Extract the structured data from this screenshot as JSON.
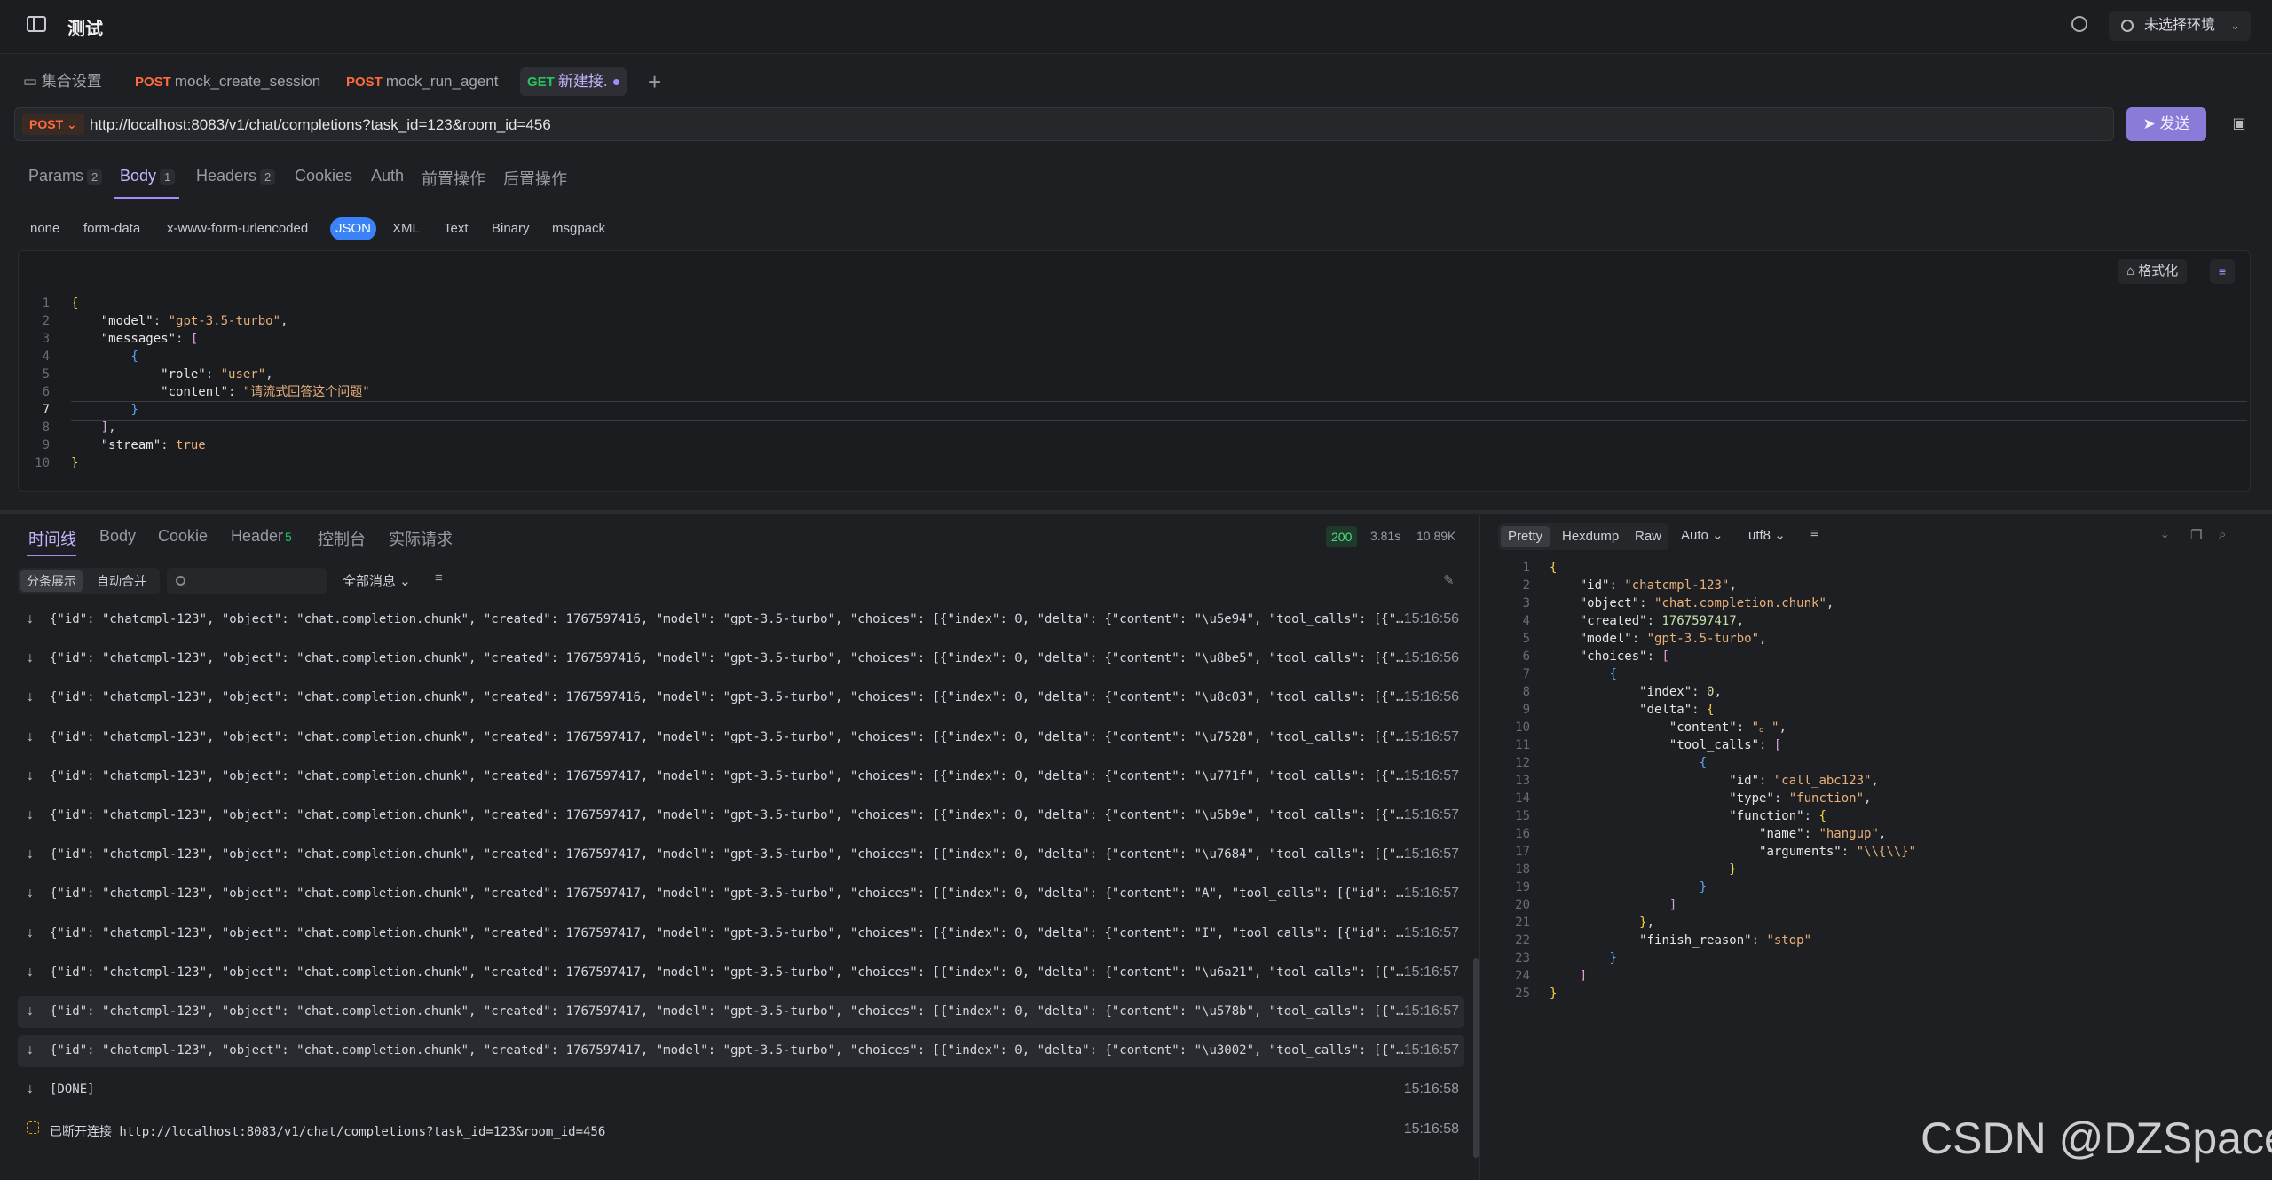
{
  "window": {
    "title": "测试"
  },
  "top_right": {
    "env_label": "未选择环境"
  },
  "tabs": [
    {
      "method": "",
      "label": "集合设置"
    },
    {
      "method": "POST",
      "label": "mock_create_session"
    },
    {
      "method": "POST",
      "label": "mock_run_agent"
    },
    {
      "method": "GET",
      "label": "新建接."
    }
  ],
  "request": {
    "method": "POST",
    "url": "http://localhost:8083/v1/chat/completions?task_id=123&room_id=456",
    "send_label": "发送"
  },
  "request_tabs": [
    {
      "label": "Params",
      "count": "2"
    },
    {
      "label": "Body",
      "count": "1"
    },
    {
      "label": "Headers",
      "count": "2"
    },
    {
      "label": "Cookies",
      "count": ""
    },
    {
      "label": "Auth",
      "count": ""
    },
    {
      "label": "前置操作",
      "count": ""
    },
    {
      "label": "后置操作",
      "count": ""
    }
  ],
  "body_types": [
    "none",
    "form-data",
    "x-www-form-urlencoded",
    "JSON",
    "XML",
    "Text",
    "Binary",
    "msgpack"
  ],
  "editor": {
    "format_label": "格式化",
    "lines": [
      "{",
      "    \"model\": \"gpt-3.5-turbo\",",
      "    \"messages\": [",
      "        {",
      "            \"role\": \"user\",",
      "            \"content\": \"请流式回答这个问题\"",
      "        }",
      "    ],",
      "    \"stream\": true",
      "}"
    ],
    "current_line": "7"
  },
  "response_tabs": [
    {
      "label": "时间线",
      "count": ""
    },
    {
      "label": "Body",
      "count": ""
    },
    {
      "label": "Cookie",
      "count": ""
    },
    {
      "label": "Header",
      "count": "5"
    },
    {
      "label": "控制台",
      "count": ""
    },
    {
      "label": "实际请求",
      "count": ""
    }
  ],
  "response_stats": {
    "status": "200",
    "time": "3.81s",
    "size": "10.89K"
  },
  "timeline": {
    "seg_split": "分条展示",
    "seg_merge": "自动合并",
    "filter_label": "全部消息",
    "events": [
      {
        "data": "{\"id\": \"chatcmpl-123\", \"object\": \"chat.completion.chunk\", \"created\": 1767597416, \"model\": \"gpt-3.5-turbo\", \"choices\": [{\"index\": 0, \"delta\": {\"content\": \"\\u5e94\", \"tool_calls\": [{\"i…",
        "time": "15:16:56"
      },
      {
        "data": "{\"id\": \"chatcmpl-123\", \"object\": \"chat.completion.chunk\", \"created\": 1767597416, \"model\": \"gpt-3.5-turbo\", \"choices\": [{\"index\": 0, \"delta\": {\"content\": \"\\u8be5\", \"tool_calls\": [{\"i…",
        "time": "15:16:56"
      },
      {
        "data": "{\"id\": \"chatcmpl-123\", \"object\": \"chat.completion.chunk\", \"created\": 1767597416, \"model\": \"gpt-3.5-turbo\", \"choices\": [{\"index\": 0, \"delta\": {\"content\": \"\\u8c03\", \"tool_calls\": [{\"i…",
        "time": "15:16:56"
      },
      {
        "data": "{\"id\": \"chatcmpl-123\", \"object\": \"chat.completion.chunk\", \"created\": 1767597417, \"model\": \"gpt-3.5-turbo\", \"choices\": [{\"index\": 0, \"delta\": {\"content\": \"\\u7528\", \"tool_calls\": [{\"i…",
        "time": "15:16:57"
      },
      {
        "data": "{\"id\": \"chatcmpl-123\", \"object\": \"chat.completion.chunk\", \"created\": 1767597417, \"model\": \"gpt-3.5-turbo\", \"choices\": [{\"index\": 0, \"delta\": {\"content\": \"\\u771f\", \"tool_calls\": [{\"i…",
        "time": "15:16:57"
      },
      {
        "data": "{\"id\": \"chatcmpl-123\", \"object\": \"chat.completion.chunk\", \"created\": 1767597417, \"model\": \"gpt-3.5-turbo\", \"choices\": [{\"index\": 0, \"delta\": {\"content\": \"\\u5b9e\", \"tool_calls\": [{\"i…",
        "time": "15:16:57"
      },
      {
        "data": "{\"id\": \"chatcmpl-123\", \"object\": \"chat.completion.chunk\", \"created\": 1767597417, \"model\": \"gpt-3.5-turbo\", \"choices\": [{\"index\": 0, \"delta\": {\"content\": \"\\u7684\", \"tool_calls\": [{\"i…",
        "time": "15:16:57"
      },
      {
        "data": "{\"id\": \"chatcmpl-123\", \"object\": \"chat.completion.chunk\", \"created\": 1767597417, \"model\": \"gpt-3.5-turbo\", \"choices\": [{\"index\": 0, \"delta\": {\"content\": \"A\", \"tool_calls\": [{\"id\": \"…",
        "time": "15:16:57"
      },
      {
        "data": "{\"id\": \"chatcmpl-123\", \"object\": \"chat.completion.chunk\", \"created\": 1767597417, \"model\": \"gpt-3.5-turbo\", \"choices\": [{\"index\": 0, \"delta\": {\"content\": \"I\", \"tool_calls\": [{\"id\": \"…",
        "time": "15:16:57"
      },
      {
        "data": "{\"id\": \"chatcmpl-123\", \"object\": \"chat.completion.chunk\", \"created\": 1767597417, \"model\": \"gpt-3.5-turbo\", \"choices\": [{\"index\": 0, \"delta\": {\"content\": \"\\u6a21\", \"tool_calls\": [{\"i…",
        "time": "15:16:57"
      },
      {
        "data": "{\"id\": \"chatcmpl-123\", \"object\": \"chat.completion.chunk\", \"created\": 1767597417, \"model\": \"gpt-3.5-turbo\", \"choices\": [{\"index\": 0, \"delta\": {\"content\": \"\\u578b\", \"tool_calls\": [{\"i…",
        "time": "15:16:57"
      },
      {
        "data": "{\"id\": \"chatcmpl-123\", \"object\": \"chat.completion.chunk\", \"created\": 1767597417, \"model\": \"gpt-3.5-turbo\", \"choices\": [{\"index\": 0, \"delta\": {\"content\": \"\\u3002\", \"tool_calls\": [{\"i…",
        "time": "15:16:57"
      },
      {
        "data": "[DONE]",
        "time": "15:16:58"
      },
      {
        "data": "已断开连接 http://localhost:8083/v1/chat/completions?task_id=123&room_id=456",
        "time": "15:16:58"
      }
    ]
  },
  "viewer": {
    "modes": [
      "Pretty",
      "Hexdump",
      "Raw"
    ],
    "auto_label": "Auto",
    "encoding_label": "utf8",
    "lines": [
      "{",
      "    \"id\": \"chatcmpl-123\",",
      "    \"object\": \"chat.completion.chunk\",",
      "    \"created\": 1767597417,",
      "    \"model\": \"gpt-3.5-turbo\",",
      "    \"choices\": [",
      "        {",
      "            \"index\": 0,",
      "            \"delta\": {",
      "                \"content\": \"。\",",
      "                \"tool_calls\": [",
      "                    {",
      "                        \"id\": \"call_abc123\",",
      "                        \"type\": \"function\",",
      "                        \"function\": {",
      "                            \"name\": \"hangup\",",
      "                            \"arguments\": \"\\\\{\\\\}\"",
      "                        }",
      "                    }",
      "                ]",
      "            },",
      "            \"finish_reason\": \"stop\"",
      "        }",
      "    ]",
      "}"
    ]
  },
  "watermark": "CSDN @DZSpace"
}
